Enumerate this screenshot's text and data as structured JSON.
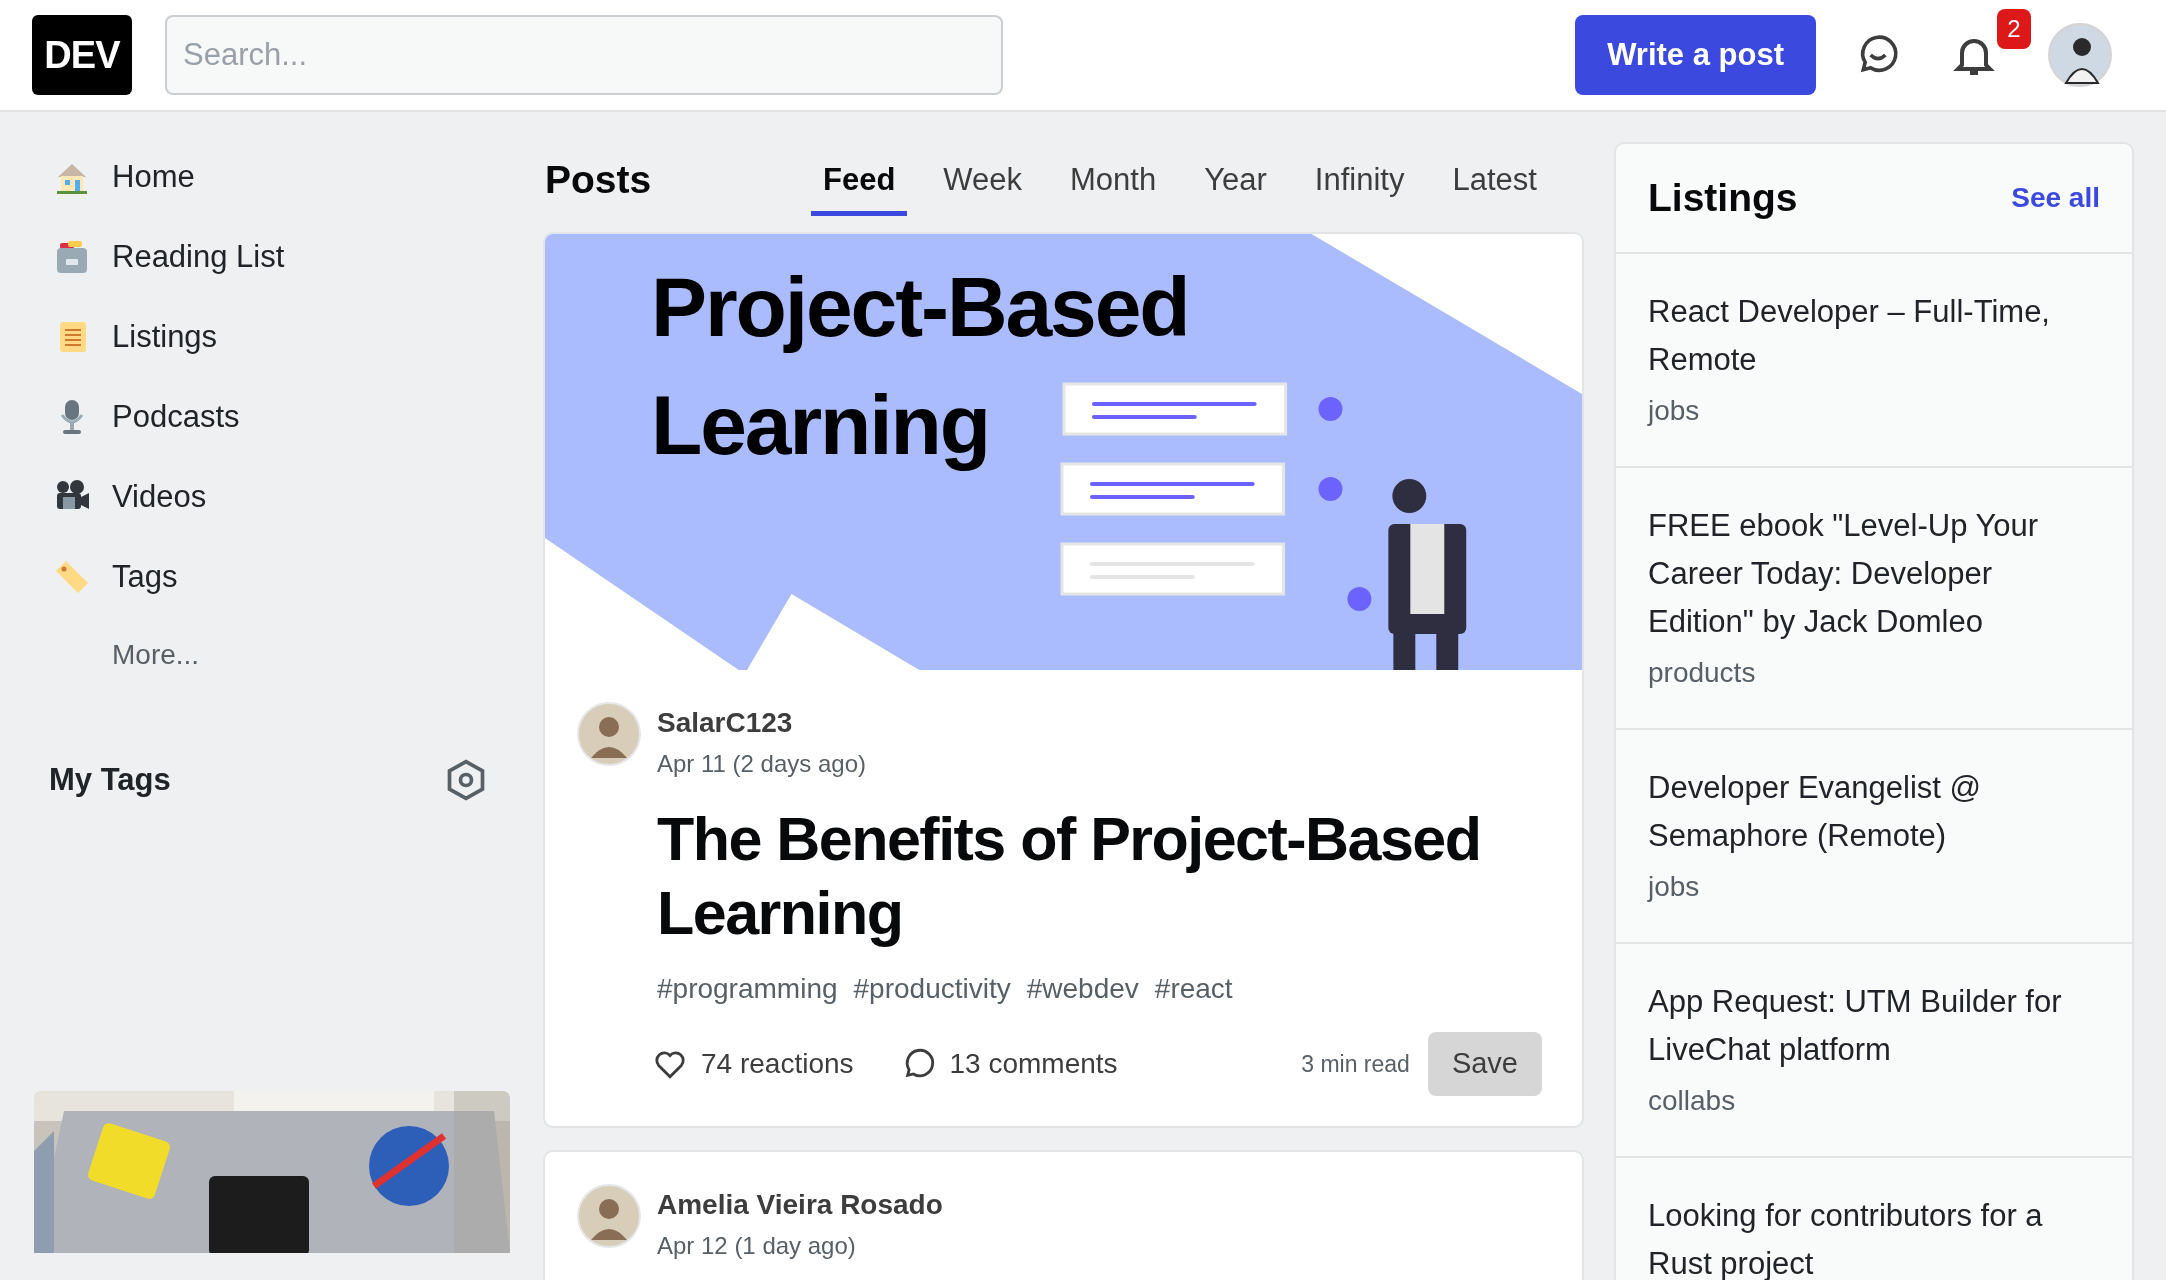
{
  "header": {
    "logo": "DEV",
    "search": {
      "placeholder": "Search..."
    },
    "write_button": "Write a post",
    "notifications_count": "2"
  },
  "sidebar": {
    "items": [
      {
        "label": "Home",
        "kind": "home"
      },
      {
        "label": "Reading List",
        "kind": "reading"
      },
      {
        "label": "Listings",
        "kind": "listings"
      },
      {
        "label": "Podcasts",
        "kind": "podcasts"
      },
      {
        "label": "Videos",
        "kind": "videos"
      },
      {
        "label": "Tags",
        "kind": "tags"
      }
    ],
    "more": "More...",
    "my_tags": "My Tags"
  },
  "feed": {
    "title": "Posts",
    "tabs": [
      {
        "label": "Feed",
        "selected": true
      },
      {
        "label": "Week",
        "selected": false
      },
      {
        "label": "Month",
        "selected": false
      },
      {
        "label": "Year",
        "selected": false
      },
      {
        "label": "Infinity",
        "selected": false
      },
      {
        "label": "Latest",
        "selected": false
      }
    ],
    "posts": [
      {
        "cover_title": [
          "Project-Based",
          "Learning"
        ],
        "author": "SalarC123",
        "date": "Apr 11 (2 days ago)",
        "title": "The Benefits of Project-Based Learning",
        "tags": [
          "#programming",
          "#productivity",
          "#webdev",
          "#react"
        ],
        "reactions": "74 reactions",
        "comments": "13 comments",
        "read_time": "3 min read",
        "save": "Save"
      },
      {
        "author": "Amelia Vieira Rosado",
        "date": "Apr 12 (1 day ago)"
      }
    ]
  },
  "listings": {
    "title": "Listings",
    "see_all": "See all",
    "items": [
      {
        "title": "React Developer – Full-Time, Remote",
        "category": "jobs"
      },
      {
        "title": "FREE ebook \"Level-Up Your Career Today: Developer Edition\" by Jack Domleo",
        "category": "products"
      },
      {
        "title": "Developer Evangelist @ Semaphore (Remote)",
        "category": "jobs"
      },
      {
        "title": "App Request: UTM Builder for LiveChat platform",
        "category": "collabs"
      },
      {
        "title": "Looking for contributors for a Rust project"
      }
    ]
  }
}
